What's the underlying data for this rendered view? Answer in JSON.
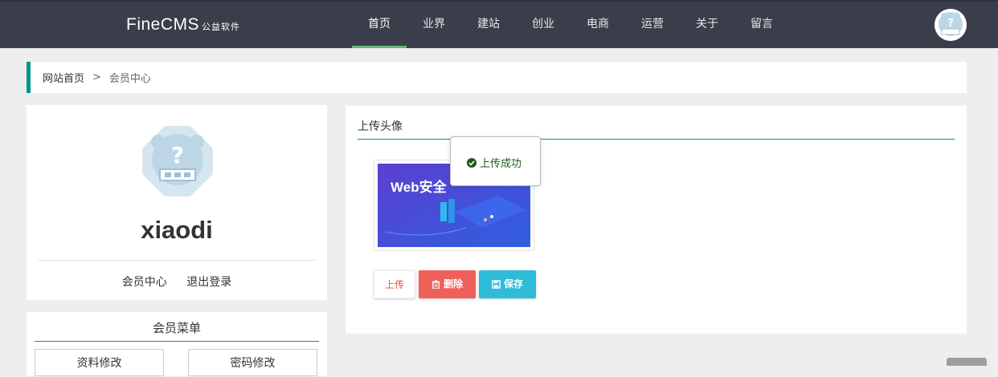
{
  "header": {
    "logo_main": "FineCMS",
    "logo_sub": "公益软件",
    "nav": [
      {
        "label": "首页",
        "active": true
      },
      {
        "label": "业界",
        "active": false
      },
      {
        "label": "建站",
        "active": false
      },
      {
        "label": "创业",
        "active": false
      },
      {
        "label": "电商",
        "active": false
      },
      {
        "label": "运营",
        "active": false
      },
      {
        "label": "关于",
        "active": false
      },
      {
        "label": "留言",
        "active": false
      }
    ]
  },
  "breadcrumb": {
    "home": "网站首页",
    "separator": ">",
    "current": "会员中心"
  },
  "profile": {
    "username": "xiaodi",
    "member_center": "会员中心",
    "logout": "退出登录"
  },
  "member_menu": {
    "title": "会员菜单",
    "items": [
      "资料修改",
      "密码修改"
    ]
  },
  "upload": {
    "title": "上传头像",
    "preview_text": "Web安全",
    "upload_label": "上传",
    "delete_label": "删除",
    "save_label": "保存"
  },
  "toast": {
    "message": "上传成功"
  },
  "colors": {
    "topbar": "#3a3e4a",
    "accent": "#009688",
    "nav_active": "#5fb878",
    "delete": "#f0605a",
    "save": "#2fbcd8",
    "toast_text": "#1d5c1a"
  },
  "icons": {
    "toast": "check-circle-icon",
    "delete": "trash-icon",
    "save": "floppy-disk-icon",
    "avatar": "placeholder-bear-avatar"
  }
}
